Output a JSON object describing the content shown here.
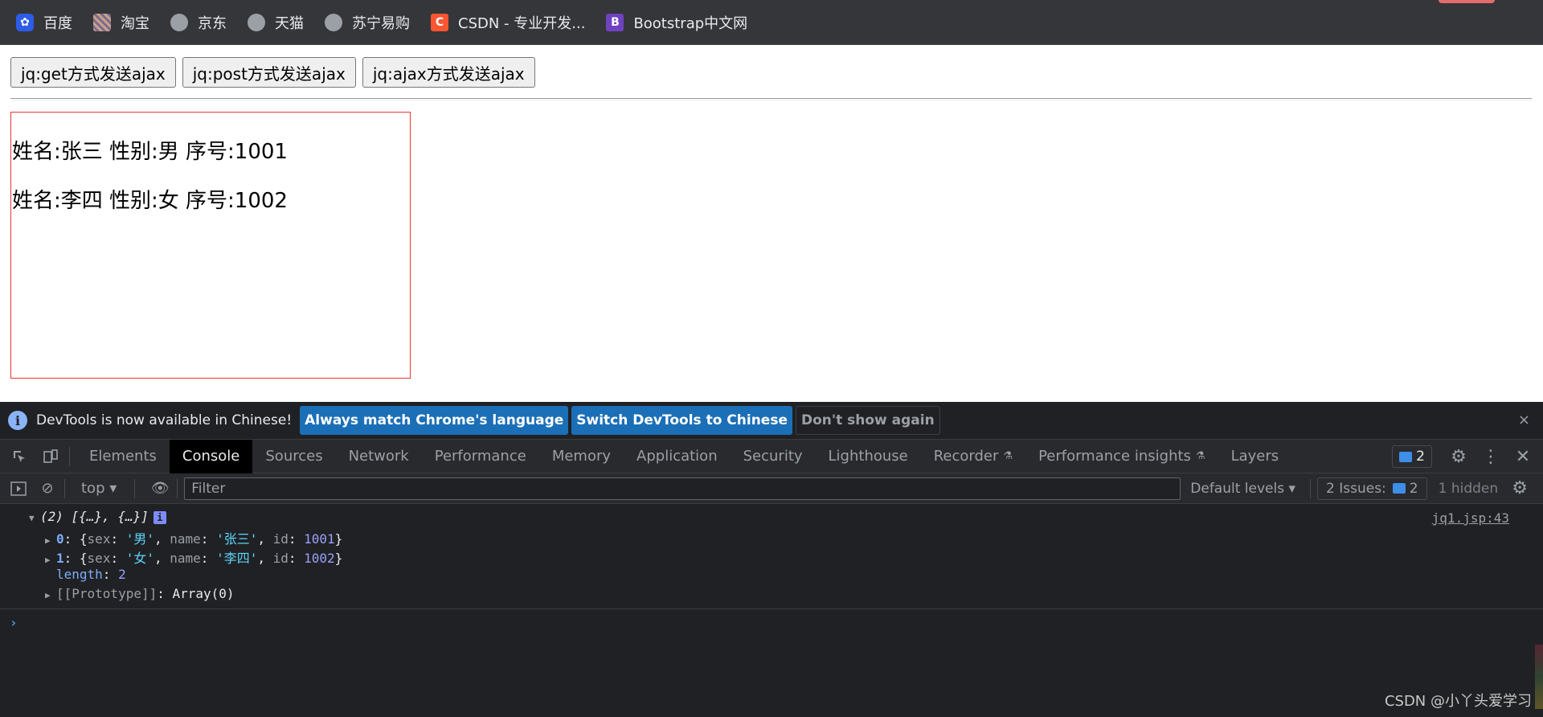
{
  "bookmarks": [
    {
      "label": "百度",
      "icon": "baidu-icon"
    },
    {
      "label": "淘宝",
      "icon": "taobao-icon"
    },
    {
      "label": "京东",
      "icon": "globe-icon"
    },
    {
      "label": "天猫",
      "icon": "globe-icon"
    },
    {
      "label": "苏宁易购",
      "icon": "globe-icon"
    },
    {
      "label": "CSDN - 专业开发...",
      "icon": "csdn-icon",
      "glyph": "C"
    },
    {
      "label": "Bootstrap中文网",
      "icon": "bootstrap-icon",
      "glyph": "B"
    }
  ],
  "page": {
    "buttons": [
      "jq:get方式发送ajax",
      "jq:post方式发送ajax",
      "jq:ajax方式发送ajax"
    ],
    "records": [
      "姓名:张三 性别:男 序号:1001",
      "姓名:李四 性别:女 序号:1002"
    ]
  },
  "devtools": {
    "infobar": {
      "message": "DevTools is now available in Chinese!",
      "btn_match": "Always match Chrome's language",
      "btn_switch": "Switch DevTools to Chinese",
      "btn_dismiss": "Don't show again",
      "close": "×"
    },
    "tabs": [
      "Elements",
      "Console",
      "Sources",
      "Network",
      "Performance",
      "Memory",
      "Application",
      "Security",
      "Lighthouse",
      "Recorder",
      "Performance insights",
      "Layers"
    ],
    "active_tab": "Console",
    "message_count": "2",
    "filterbar": {
      "context": "top",
      "filter_placeholder": "Filter",
      "levels": "Default levels",
      "issues_label": "2 Issues:",
      "issues_count": "2",
      "hidden": "1 hidden"
    },
    "console": {
      "summary": "(2) [{…}, {…}]",
      "source": "jq1.jsp:43",
      "rows": [
        {
          "index": "0",
          "sex": "'男'",
          "name": "'张三'",
          "id": "1001"
        },
        {
          "index": "1",
          "sex": "'女'",
          "name": "'李四'",
          "id": "1002"
        }
      ],
      "length_key": "length",
      "length_val": "2",
      "proto_key": "[[Prototype]]",
      "proto_val": "Array(0)",
      "prompt": "›"
    }
  },
  "watermark": "CSDN @小丫头爱学习",
  "colors": {
    "accent_blue": "#1b6fb7",
    "red_border": "#e53935",
    "console_bg": "#202124"
  }
}
